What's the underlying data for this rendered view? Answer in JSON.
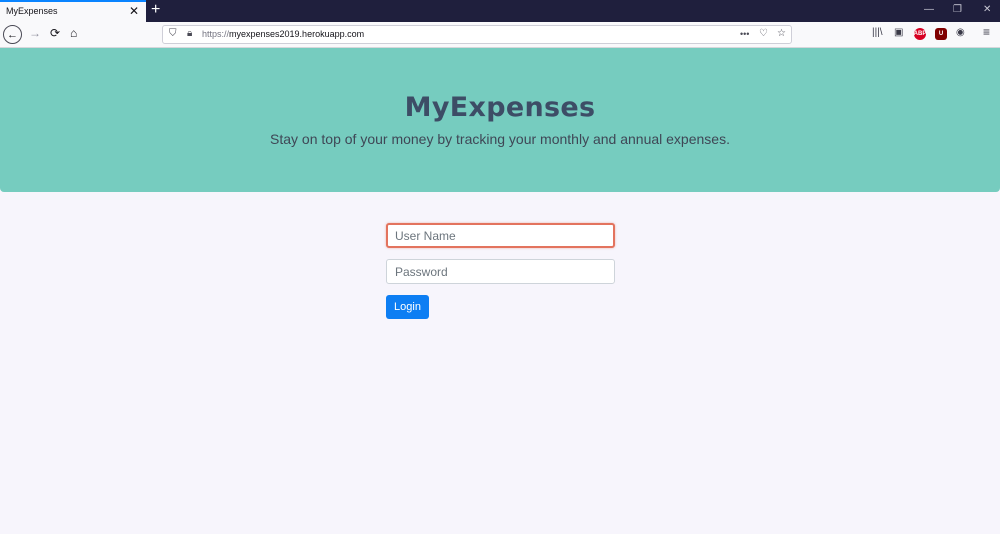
{
  "browser": {
    "tab_title": "MyExpenses",
    "tab_close": "✕",
    "new_tab": "+",
    "url_protocol": "https://",
    "url_host": "myexpenses2019.herokuapp.com",
    "page_actions": "•••",
    "icons": [
      "back-icon",
      "forward-icon",
      "reload-icon",
      "home-icon",
      "shield-icon",
      "lock-icon",
      "pocket-icon",
      "bookmark-star-icon",
      "library-icon",
      "sidebar-icon",
      "adblock-icon",
      "ublock-icon",
      "account-icon",
      "menu-icon"
    ],
    "ext_abp": "ABP",
    "ext_ublock": "U"
  },
  "hero": {
    "title": "MyExpenses",
    "subtitle": "Stay on top of your money by tracking your monthly and annual expenses."
  },
  "form": {
    "username_placeholder": "User Name",
    "password_placeholder": "Password",
    "login_label": "Login"
  },
  "colors": {
    "hero_bg": "#76ccbf",
    "page_bg": "#f7f5fc",
    "button_bg": "#0d7ef3",
    "focus_border": "#e3735e"
  }
}
